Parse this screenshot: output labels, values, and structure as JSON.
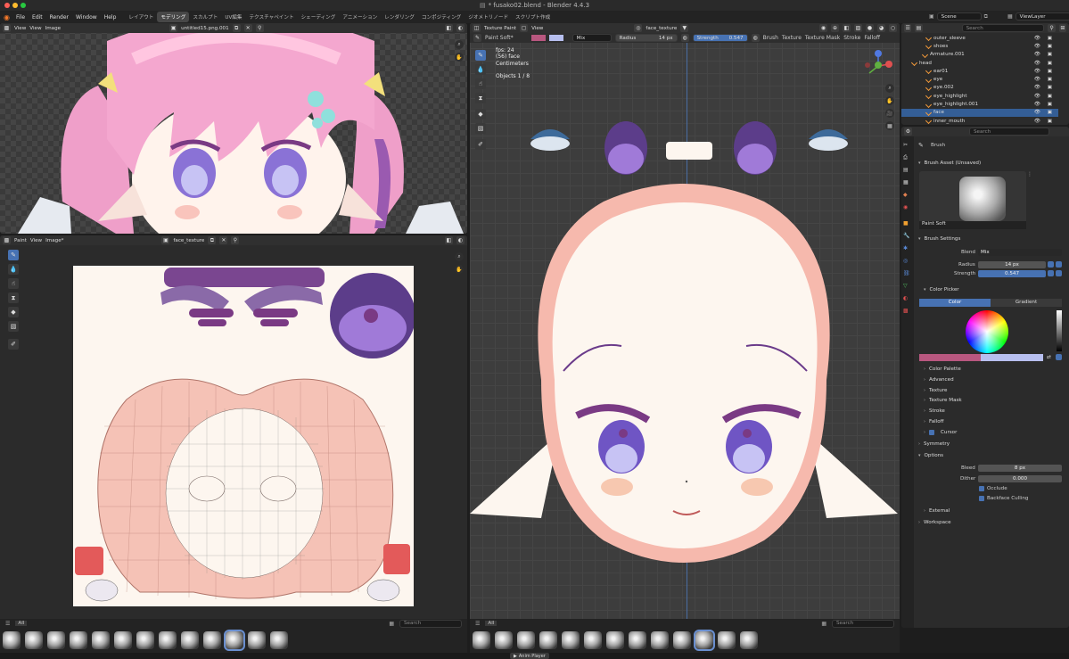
{
  "window_title": "* fusako02.blend - Blender 4.4.3",
  "menu": [
    "File",
    "Edit",
    "Render",
    "Window",
    "Help"
  ],
  "workspaces": [
    "レイアウト",
    "モデリング",
    "スカルプト",
    "UV編集",
    "テクスチャペイント",
    "シェーディング",
    "アニメーション",
    "レンダリング",
    "コンポジティング",
    "ジオメトリノード",
    "スクリプト作成"
  ],
  "active_workspace": 1,
  "scene": "Scene",
  "view_layer": "ViewLayer",
  "image_editor_top": {
    "mode": "View",
    "menus": [
      "View",
      "Image"
    ],
    "image": "untitled15.png.001"
  },
  "image_editor_bottom": {
    "mode": "Paint",
    "menus": [
      "View",
      "Image*"
    ],
    "image": "face_texture"
  },
  "viewport": {
    "mode": "Texture Paint",
    "menus": [
      "View"
    ],
    "texture": "face_texture",
    "brush": "Paint Soft*",
    "blend": "Mix",
    "radius_label": "Radius",
    "radius": "14 px",
    "strength_label": "Strength",
    "strength": "0.547",
    "header_menus": [
      "Brush",
      "Texture",
      "Texture Mask",
      "Stroke",
      "Falloff"
    ],
    "overlay": [
      "fps: 24",
      "(56) face",
      "Centimeters",
      "",
      "Objects  1 / 8"
    ]
  },
  "outliner": {
    "search_placeholder": "Search",
    "rows": [
      {
        "label": "outer_sleeve",
        "indent": 28,
        "sel": false
      },
      {
        "label": "shoes",
        "indent": 28,
        "sel": false
      },
      {
        "label": "Armature.001",
        "indent": 24,
        "sel": false
      },
      {
        "label": "head",
        "indent": 12,
        "sel": false
      },
      {
        "label": "ear01",
        "indent": 28,
        "sel": false
      },
      {
        "label": "eye",
        "indent": 28,
        "sel": false
      },
      {
        "label": "eye.002",
        "indent": 28,
        "sel": false
      },
      {
        "label": "eye_highlight",
        "indent": 28,
        "sel": false
      },
      {
        "label": "eye_highlight.001",
        "indent": 28,
        "sel": false
      },
      {
        "label": "face",
        "indent": 28,
        "sel": true
      },
      {
        "label": "inner_mouth",
        "indent": 28,
        "sel": false
      }
    ]
  },
  "properties": {
    "search_placeholder": "Search",
    "title": "Brush",
    "asset_header": "Brush Asset (Unsaved)",
    "brush_name": "Paint Soft",
    "settings_header": "Brush Settings",
    "blend_label": "Blend",
    "blend": "Mix",
    "radius_label": "Radius",
    "radius": "14 px",
    "strength_label": "Strength",
    "strength": "0.547",
    "color_picker": "Color Picker",
    "tabs": [
      "Color",
      "Gradient"
    ],
    "subpanels": [
      "Color Palette",
      "Advanced",
      "Texture",
      "Texture Mask",
      "Stroke",
      "Falloff"
    ],
    "cursor": "Cursor",
    "symmetry": "Symmetry",
    "options": "Options",
    "bleed_label": "Bleed",
    "bleed": "8 px",
    "dither_label": "Dither",
    "dither": "0.000",
    "occlude": "Occlude",
    "backface": "Backface Culling",
    "external": "External",
    "workspace": "Workspace"
  },
  "shelf": {
    "all_label": "All",
    "search_placeholder": "Search"
  },
  "status_bar": "Anim Player",
  "colors": {
    "primary": "#b8577f",
    "secondary": "#b7bfef",
    "accent": "#4772b3"
  }
}
